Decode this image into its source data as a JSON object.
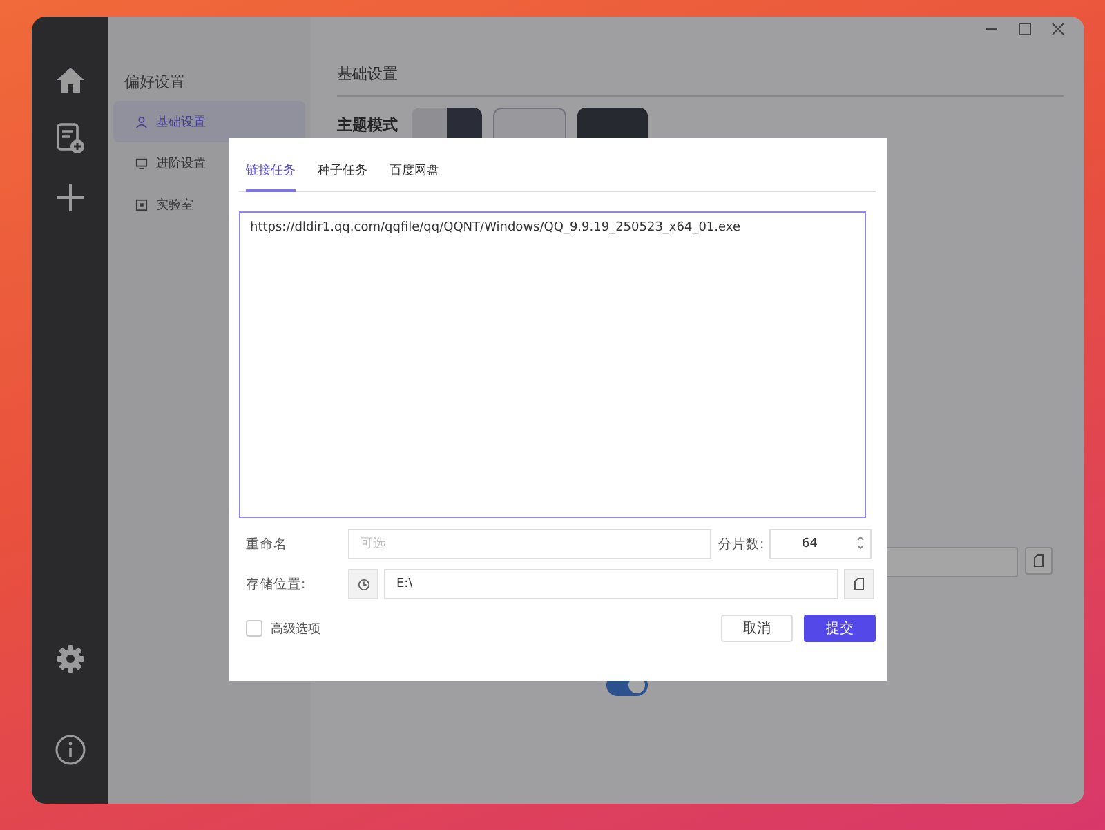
{
  "sidebar": {
    "title": "偏好设置",
    "items": [
      {
        "label": "基础设置",
        "selected": true
      },
      {
        "label": "进阶设置",
        "selected": false
      },
      {
        "label": "实验室",
        "selected": false
      }
    ]
  },
  "main": {
    "title": "基础设置",
    "theme_label": "主题模式",
    "themes": [
      {
        "kind": "mixed"
      },
      {
        "kind": "light"
      },
      {
        "kind": "dark"
      }
    ],
    "toggle": {
      "on": true
    }
  },
  "dialog": {
    "tabs": [
      {
        "label": "链接任务",
        "selected": true
      },
      {
        "label": "种子任务",
        "selected": false
      },
      {
        "label": "百度网盘",
        "selected": false
      }
    ],
    "url": "https://dldir1.qq.com/qqfile/qq/QQNT/Windows/QQ_9.9.19_250523_x64_01.exe",
    "rename": {
      "label": "重命名",
      "placeholder": "可选"
    },
    "shards": {
      "label": "分片数:",
      "value": "64"
    },
    "storage": {
      "label": "存储位置:",
      "value": "E:\\"
    },
    "advanced": {
      "label": "高级选项",
      "checked": false
    },
    "buttons": [
      {
        "label": "取消",
        "kind": "secondary"
      },
      {
        "label": "提交",
        "kind": "primary"
      }
    ]
  }
}
